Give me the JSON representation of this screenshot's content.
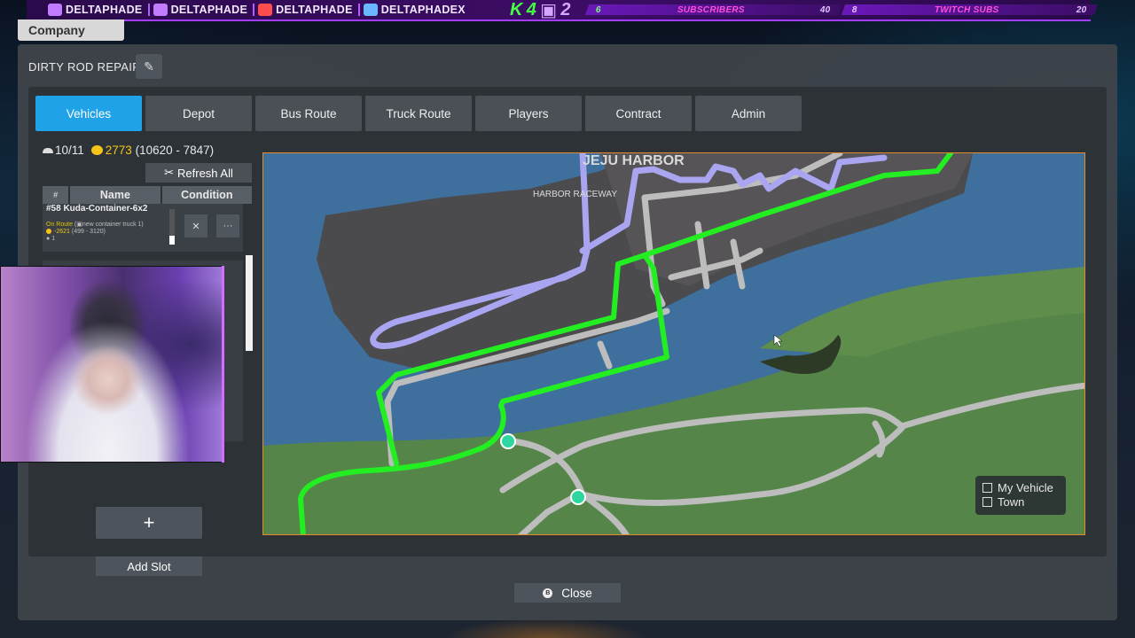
{
  "stream_overlay": {
    "socials": [
      {
        "icon": "twitch-icon",
        "handle": "DELTAPHADE"
      },
      {
        "icon": "instagram-icon",
        "handle": "DELTAPHADE"
      },
      {
        "icon": "youtube-icon",
        "handle": "DELTAPHADE"
      },
      {
        "icon": "twitter-icon",
        "handle": "DELTAPHADEX"
      }
    ],
    "kick_count": "4",
    "twitch_count": "2",
    "subscribers": {
      "current": "6",
      "label": "SUBSCRIBERS",
      "goal": "40"
    },
    "twitch_subs": {
      "current": "8",
      "label": "TWITCH SUBS",
      "goal": "20"
    }
  },
  "company_tab": "Company",
  "window": {
    "title": "DIRTY ROD REPAIR",
    "tabs": [
      "Vehicles",
      "Depot",
      "Bus Route",
      "Truck Route",
      "Players",
      "Contract",
      "Admin"
    ],
    "active_tab": "Vehicles"
  },
  "vehicles": {
    "count": "10/11",
    "money": "2773",
    "money_range": "(10620 - 7847)",
    "refresh_label": "Refresh All",
    "columns": [
      "#",
      "Name",
      "Condition"
    ],
    "rows": [
      {
        "title": "#58 Kuda-Container-6x2",
        "status": "On Route",
        "cargo": "new container truck 1",
        "earning": "-2621",
        "range": "(499 - 3120)",
        "passengers": "1"
      }
    ],
    "add_plus_label": "+",
    "add_slot_label": "Add Slot"
  },
  "map": {
    "place_label": "JEJU HARBOR",
    "area_label": "HARBOR RACEWAY",
    "legend": [
      {
        "label": "My Vehicle",
        "checked": false
      },
      {
        "label": "Town",
        "checked": false
      }
    ],
    "colors": {
      "water": "#3e6e9e",
      "land": "#5a8a4a",
      "town": "#4a4a4c",
      "truck_route": "#22ee22",
      "bus_route": "#a8a6f2",
      "road": "#bcbcbc"
    }
  },
  "close_label": "Close",
  "close_key": "B"
}
